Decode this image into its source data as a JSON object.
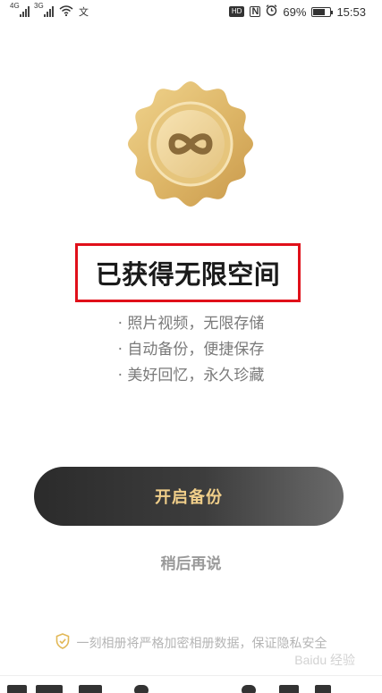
{
  "status_bar": {
    "net1": "4G",
    "net2": "3G",
    "wifi_icon": "wifi-icon",
    "extra_icon": "文",
    "hd_badge": "HD",
    "nfc": "N",
    "alarm_icon": "alarm-icon",
    "battery_percent": "69%",
    "battery_level": 0.69,
    "time": "15:53"
  },
  "medal": {
    "icon": "infinity-icon",
    "colors": {
      "outer": "#e2bf73",
      "inner": "#f3dca6",
      "symbol": "#8a6b3a"
    }
  },
  "title": "已获得无限空间",
  "features": [
    "· 照片视频，无限存储",
    "· 自动备份，便捷保存",
    "· 美好回忆，永久珍藏"
  ],
  "primary_button": {
    "label": "开启备份",
    "text_color": "#f1cf8a"
  },
  "secondary_link": {
    "label": "稍后再说"
  },
  "privacy": {
    "icon": "shield-check-icon",
    "text": "一刻相册将严格加密相册数据，保证隐私安全"
  },
  "watermark": "Baidu 经验",
  "highlight_color": "#e0101a"
}
